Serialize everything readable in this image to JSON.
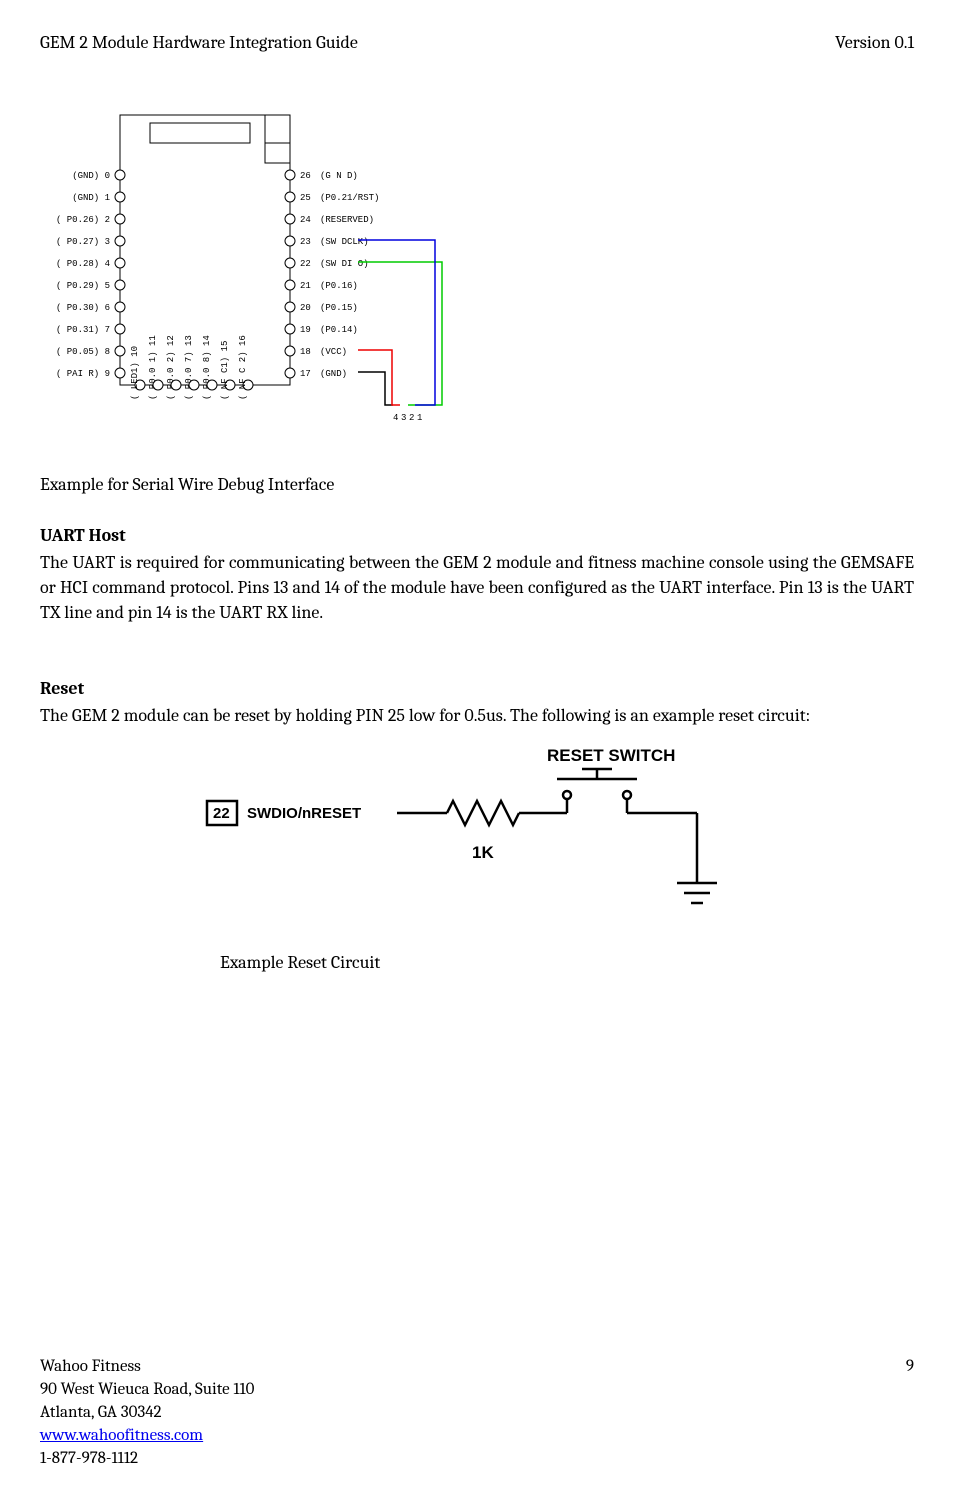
{
  "header": {
    "doc_title": "GEM 2 Module Hardware Integration Guide",
    "version": "Version 0.1"
  },
  "diagram1": {
    "left_pins": [
      {
        "num": "0",
        "label": "(GND)"
      },
      {
        "num": "1",
        "label": "(GND)"
      },
      {
        "num": "2",
        "label": "( P0.26)"
      },
      {
        "num": "3",
        "label": "( P0.27)"
      },
      {
        "num": "4",
        "label": "( P0.28)"
      },
      {
        "num": "5",
        "label": "( P0.29)"
      },
      {
        "num": "6",
        "label": "( P0.30)"
      },
      {
        "num": "7",
        "label": "( P0.31)"
      },
      {
        "num": "8",
        "label": "( P0.05)"
      },
      {
        "num": "9",
        "label": "(  PAI R)"
      }
    ],
    "bottom_pins": [
      {
        "num": "10",
        "label": "( LED1)"
      },
      {
        "num": "11",
        "label": "( P0.0 1)"
      },
      {
        "num": "12",
        "label": "( P0.0 2)"
      },
      {
        "num": "13",
        "label": "( P0.0 7)"
      },
      {
        "num": "14",
        "label": "( P0.0 8)"
      },
      {
        "num": "15",
        "label": "( NF C1)"
      },
      {
        "num": "16",
        "label": "( NF C 2)"
      }
    ],
    "right_pins": [
      {
        "num": "26",
        "label": "(G   N  D)"
      },
      {
        "num": "25",
        "label": "(P0.21/RST)"
      },
      {
        "num": "24",
        "label": "(RESERVED)"
      },
      {
        "num": "23",
        "label": "(SW DCLK)"
      },
      {
        "num": "22",
        "label": "(SW DI O)"
      },
      {
        "num": "21",
        "label": "(P0.16)"
      },
      {
        "num": "20",
        "label": "(P0.15)"
      },
      {
        "num": "19",
        "label": "(P0.14)"
      },
      {
        "num": "18",
        "label": "(VCC)"
      },
      {
        "num": "17",
        "label": "(GND)"
      }
    ],
    "connector_labels": [
      "4",
      "3",
      "2",
      "1"
    ]
  },
  "caption1": "Example for Serial Wire Debug Interface",
  "sections": {
    "uart": {
      "heading": "UART Host",
      "body": "The UART is required for communicating between the GEM 2 module and fitness machine console using the GEMSAFE or HCI command protocol. Pins 13 and 14 of the module have been configured as the UART interface.  Pin 13 is the UART TX line and pin 14 is the UART RX line."
    },
    "reset": {
      "heading": "Reset",
      "body": "The GEM 2 module can be reset by holding PIN 25 low for 0.5us. The following is an example reset circuit:"
    }
  },
  "reset_diagram": {
    "title": "RESET SWITCH",
    "pin_text": "22  SWDIO/nRESET",
    "resistor_label": "1K"
  },
  "caption2": "Example Reset Circuit",
  "footer": {
    "company": "Wahoo Fitness",
    "address1": "90 West Wieuca Road, Suite 110",
    "address2": "Atlanta, GA 30342",
    "website": "www.wahoofitness.com",
    "website_href": "http://www.wahoofitness.com",
    "phone": "1-877-978-1112",
    "page_num": "9"
  }
}
